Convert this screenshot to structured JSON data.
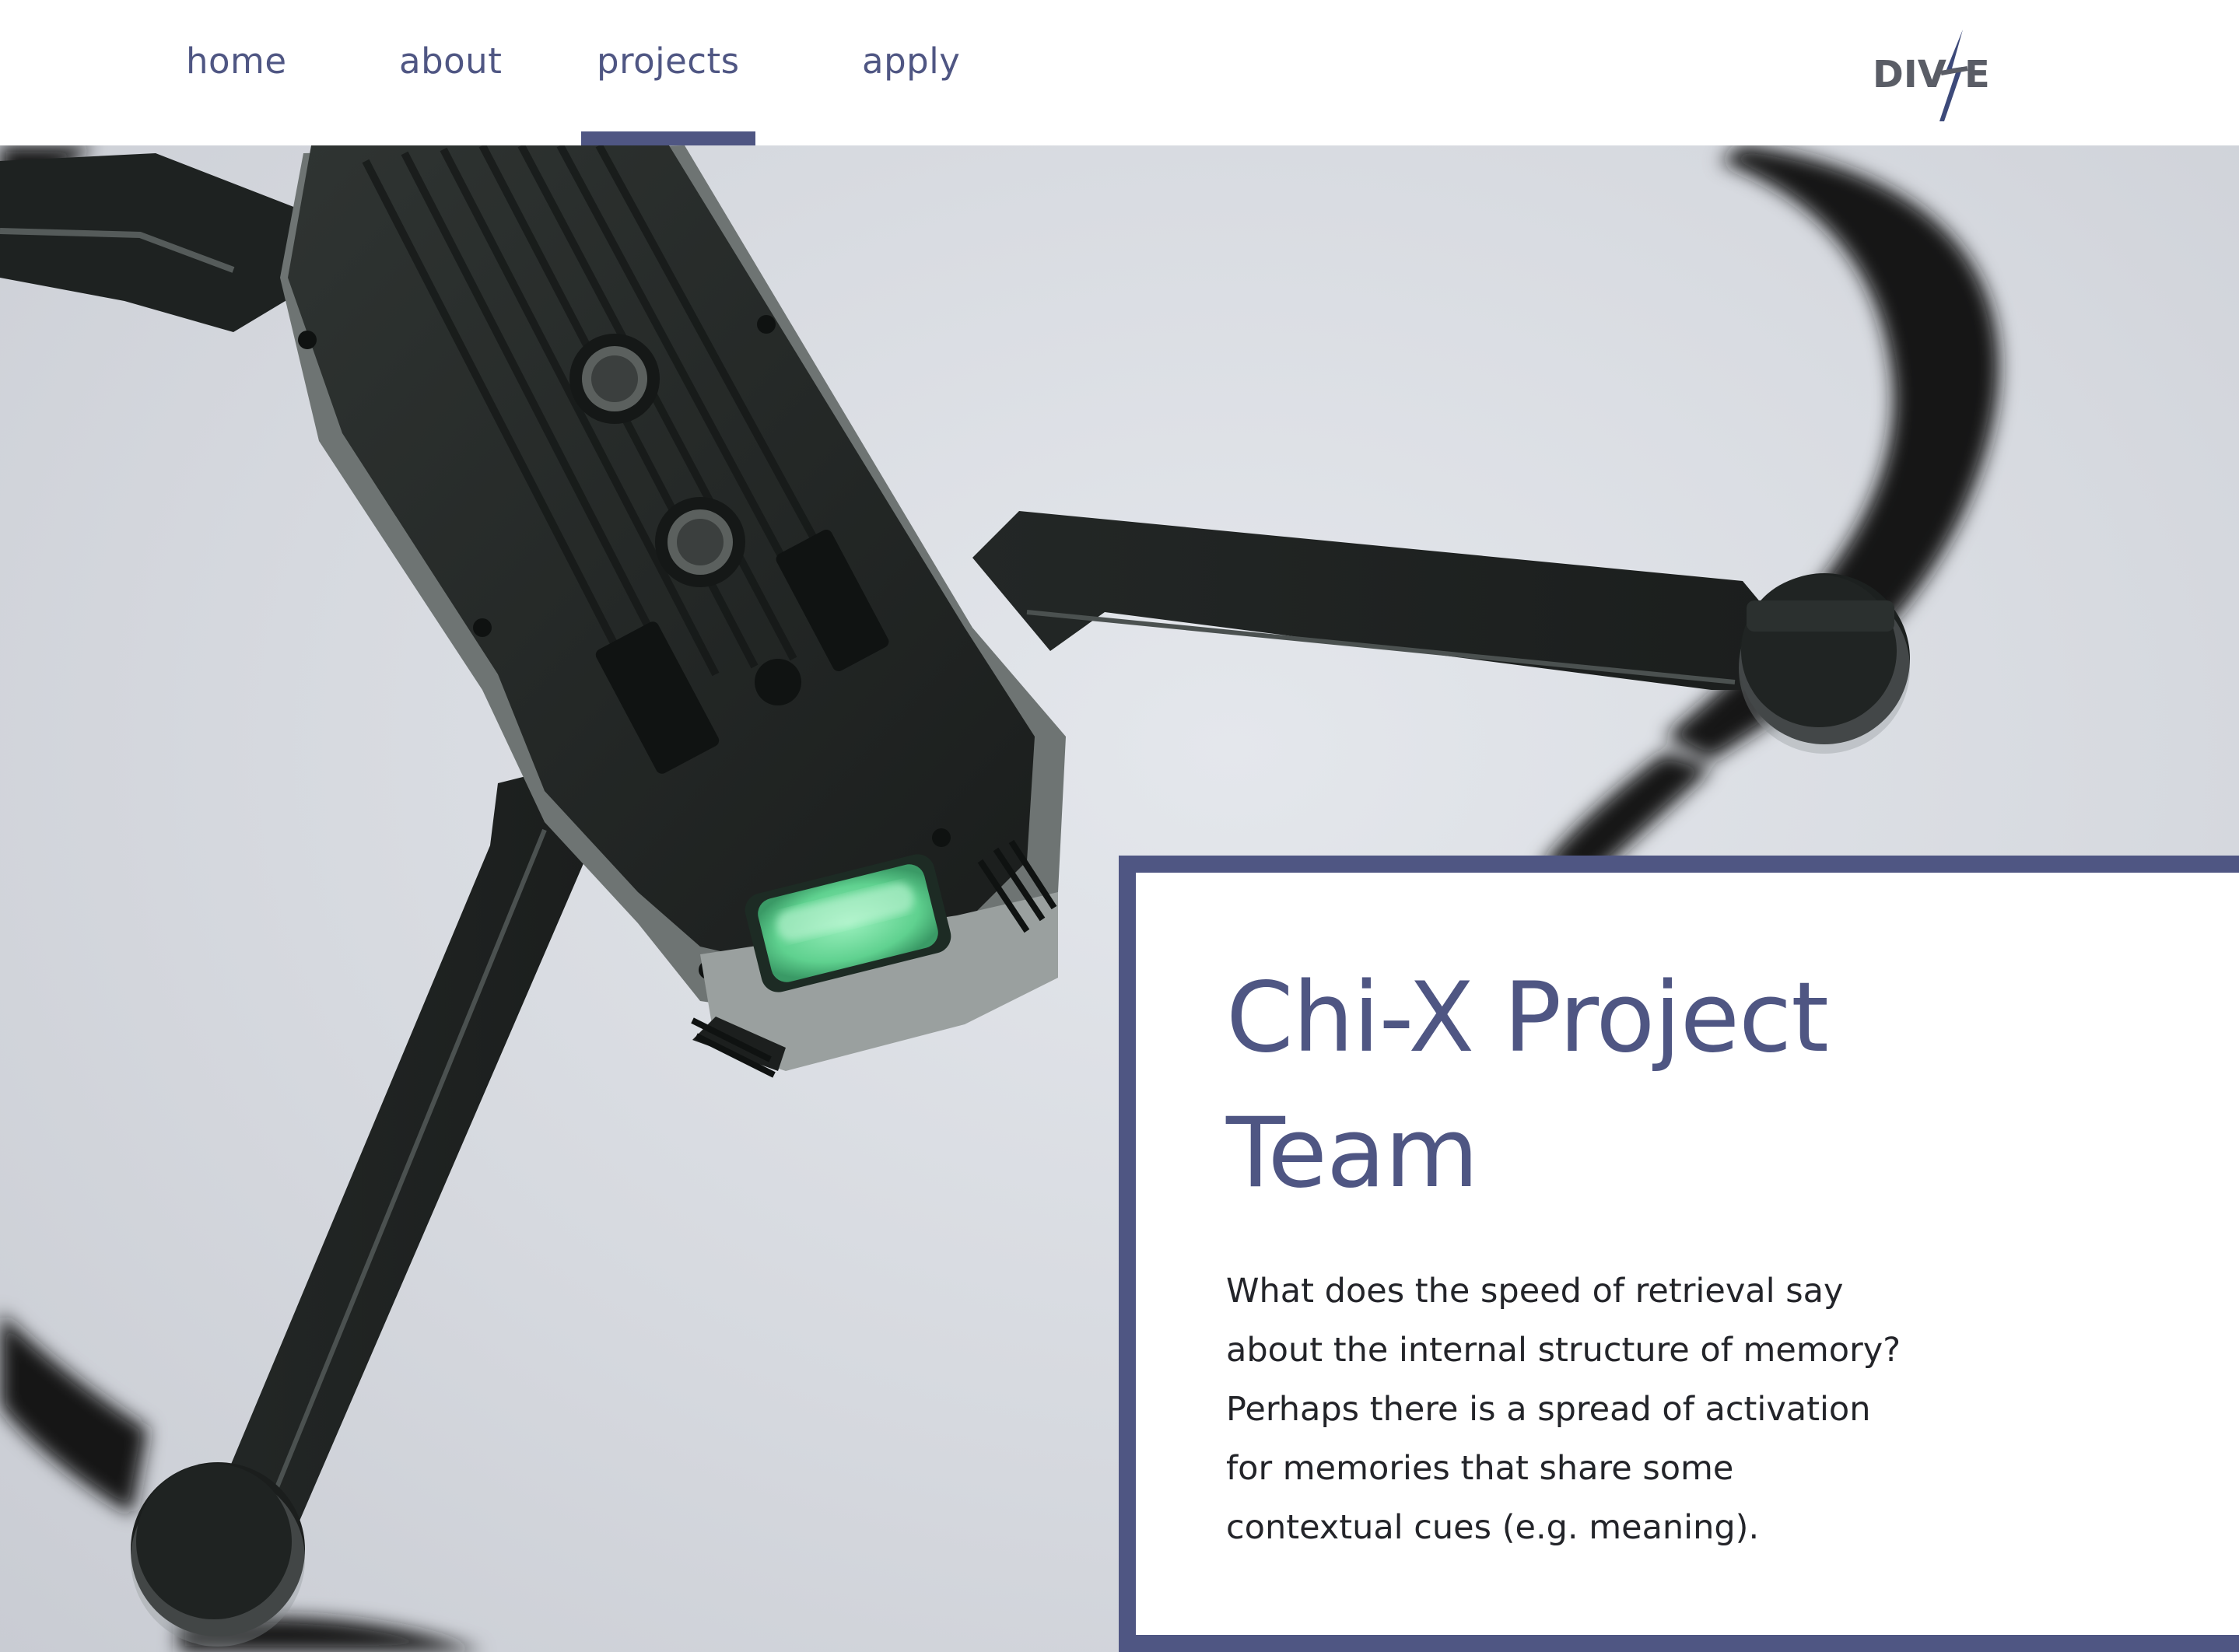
{
  "nav": {
    "items": [
      {
        "label": "home"
      },
      {
        "label": "about"
      },
      {
        "label": "projects",
        "active": true
      },
      {
        "label": "apply"
      }
    ]
  },
  "logo": {
    "text_left": "DIV",
    "text_right": "E",
    "icon": "lightning-slash-logo"
  },
  "hero": {
    "image": "drone-underside-photo",
    "status_light_color": "#7be3a6"
  },
  "card": {
    "title": "Chi-X Project Team",
    "body": "What does the speed of retrieval say about the internal structure of memory? Perhaps there is a spread of activation for memories that share some contextual cues (e.g. meaning)."
  },
  "colors": {
    "accent": "#4f5683",
    "body_text": "#232429",
    "background": "#ffffff"
  }
}
